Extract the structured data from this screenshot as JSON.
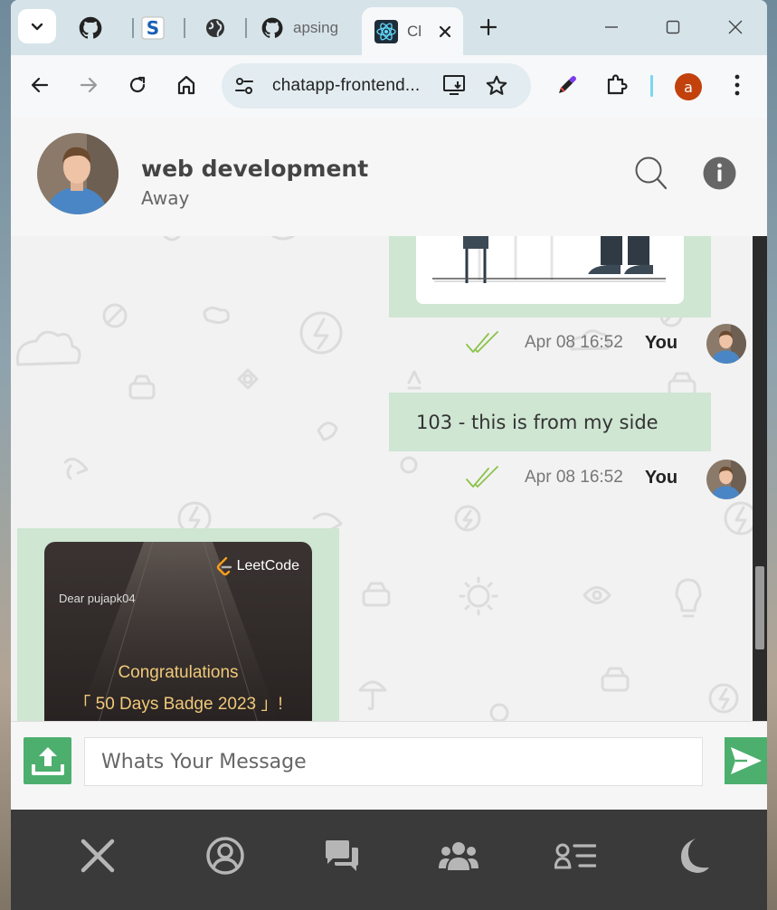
{
  "browser": {
    "tabs": [
      {
        "label": "",
        "icon": "github-icon"
      },
      {
        "label": "",
        "icon": "s-logo-icon"
      },
      {
        "label": "",
        "icon": "globe-icon"
      },
      {
        "label": "apsing",
        "icon": "github-icon"
      },
      {
        "label": "Cl",
        "icon": "react-icon",
        "active": true
      }
    ],
    "address_bar": {
      "url": "chatapp-frontend..."
    },
    "profile_initial": "a",
    "colors": {
      "profile": "#c2410c",
      "tabstrip": "#d6e4ea"
    }
  },
  "chat": {
    "contact": {
      "name": "web development",
      "status": "Away"
    },
    "messages": [
      {
        "type": "image",
        "direction": "out",
        "time": "Apr 08 16:52",
        "sender": "You"
      },
      {
        "type": "text",
        "direction": "out",
        "text": "103 - this is from my side",
        "time": "Apr 08 16:52",
        "sender": "You"
      },
      {
        "type": "image",
        "direction": "in",
        "image": {
          "logo": "LeetCode",
          "dear": "Dear pujapk04",
          "congrats": "Congratulations",
          "badge": "「 50 Days Badge 2023 」!"
        }
      }
    ],
    "input": {
      "placeholder": "Whats Your Message"
    },
    "colors": {
      "bubble": "#cfe6d2",
      "accent": "#4caf6d",
      "nav": "#3a3a3a",
      "check": "#8bc34a"
    }
  },
  "bottom_nav": [
    "close-icon",
    "profile-icon",
    "chats-icon",
    "groups-icon",
    "contacts-icon",
    "dark-mode-icon"
  ]
}
